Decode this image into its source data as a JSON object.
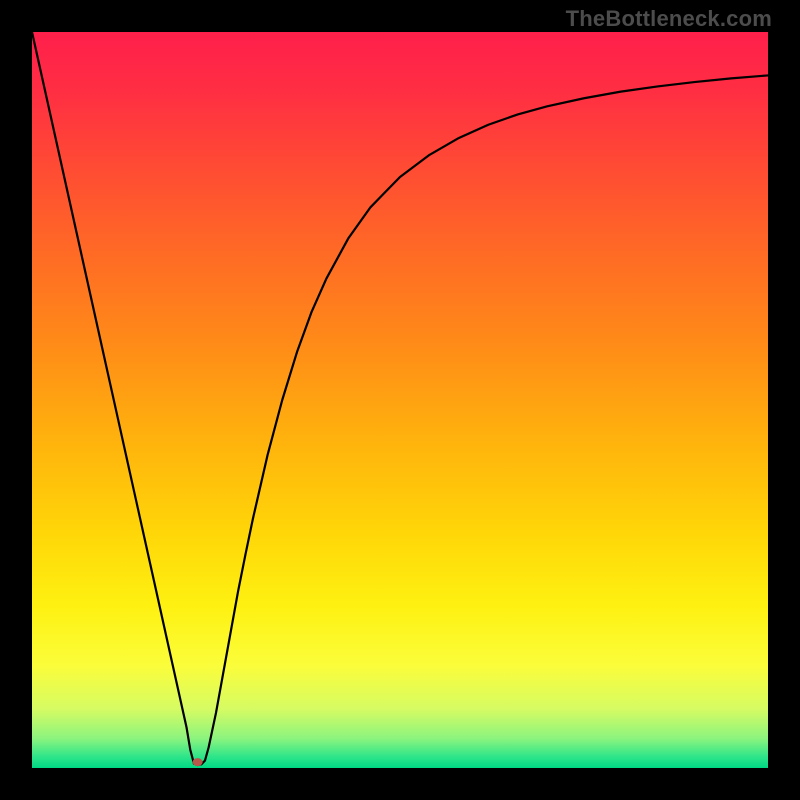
{
  "watermark": "TheBottleneck.com",
  "chart_data": {
    "type": "line",
    "title": "",
    "xlabel": "",
    "ylabel": "",
    "xlim": [
      0,
      100
    ],
    "ylim": [
      0,
      100
    ],
    "gradient": {
      "direction": "vertical",
      "stops": [
        {
          "offset": 0.0,
          "color": "#ff1f4b"
        },
        {
          "offset": 0.08,
          "color": "#ff2e43"
        },
        {
          "offset": 0.18,
          "color": "#ff4a34"
        },
        {
          "offset": 0.3,
          "color": "#ff6a25"
        },
        {
          "offset": 0.42,
          "color": "#ff8a18"
        },
        {
          "offset": 0.55,
          "color": "#ffb10d"
        },
        {
          "offset": 0.68,
          "color": "#ffd608"
        },
        {
          "offset": 0.78,
          "color": "#fef111"
        },
        {
          "offset": 0.86,
          "color": "#fbfd3a"
        },
        {
          "offset": 0.92,
          "color": "#d6fb63"
        },
        {
          "offset": 0.96,
          "color": "#8bf47e"
        },
        {
          "offset": 0.985,
          "color": "#2de58a"
        },
        {
          "offset": 1.0,
          "color": "#00d884"
        }
      ]
    },
    "marker": {
      "x": 22.5,
      "y": 0.8,
      "color": "#b85a4b",
      "rx": 5,
      "ry": 4
    },
    "series": [
      {
        "name": "curve",
        "stroke": "#000000",
        "stroke_width": 2.2,
        "points": [
          {
            "x": 0.0,
            "y": 100.0
          },
          {
            "x": 2.0,
            "y": 91.0
          },
          {
            "x": 4.0,
            "y": 82.0
          },
          {
            "x": 6.0,
            "y": 73.0
          },
          {
            "x": 8.0,
            "y": 64.0
          },
          {
            "x": 10.0,
            "y": 55.0
          },
          {
            "x": 12.0,
            "y": 46.0
          },
          {
            "x": 14.0,
            "y": 37.0
          },
          {
            "x": 16.0,
            "y": 28.0
          },
          {
            "x": 18.0,
            "y": 19.0
          },
          {
            "x": 20.0,
            "y": 10.0
          },
          {
            "x": 21.0,
            "y": 5.5
          },
          {
            "x": 21.5,
            "y": 2.5
          },
          {
            "x": 22.0,
            "y": 0.6
          },
          {
            "x": 22.5,
            "y": 0.4
          },
          {
            "x": 23.0,
            "y": 0.5
          },
          {
            "x": 23.5,
            "y": 1.0
          },
          {
            "x": 24.0,
            "y": 2.8
          },
          {
            "x": 25.0,
            "y": 7.5
          },
          {
            "x": 26.0,
            "y": 13.0
          },
          {
            "x": 27.0,
            "y": 18.5
          },
          {
            "x": 28.0,
            "y": 24.0
          },
          {
            "x": 29.0,
            "y": 29.0
          },
          {
            "x": 30.0,
            "y": 33.8
          },
          {
            "x": 32.0,
            "y": 42.5
          },
          {
            "x": 34.0,
            "y": 50.0
          },
          {
            "x": 36.0,
            "y": 56.5
          },
          {
            "x": 38.0,
            "y": 62.0
          },
          {
            "x": 40.0,
            "y": 66.5
          },
          {
            "x": 43.0,
            "y": 72.0
          },
          {
            "x": 46.0,
            "y": 76.2
          },
          {
            "x": 50.0,
            "y": 80.3
          },
          {
            "x": 54.0,
            "y": 83.3
          },
          {
            "x": 58.0,
            "y": 85.6
          },
          {
            "x": 62.0,
            "y": 87.4
          },
          {
            "x": 66.0,
            "y": 88.8
          },
          {
            "x": 70.0,
            "y": 89.9
          },
          {
            "x": 75.0,
            "y": 91.0
          },
          {
            "x": 80.0,
            "y": 91.9
          },
          {
            "x": 85.0,
            "y": 92.6
          },
          {
            "x": 90.0,
            "y": 93.2
          },
          {
            "x": 95.0,
            "y": 93.7
          },
          {
            "x": 100.0,
            "y": 94.1
          }
        ]
      }
    ]
  }
}
